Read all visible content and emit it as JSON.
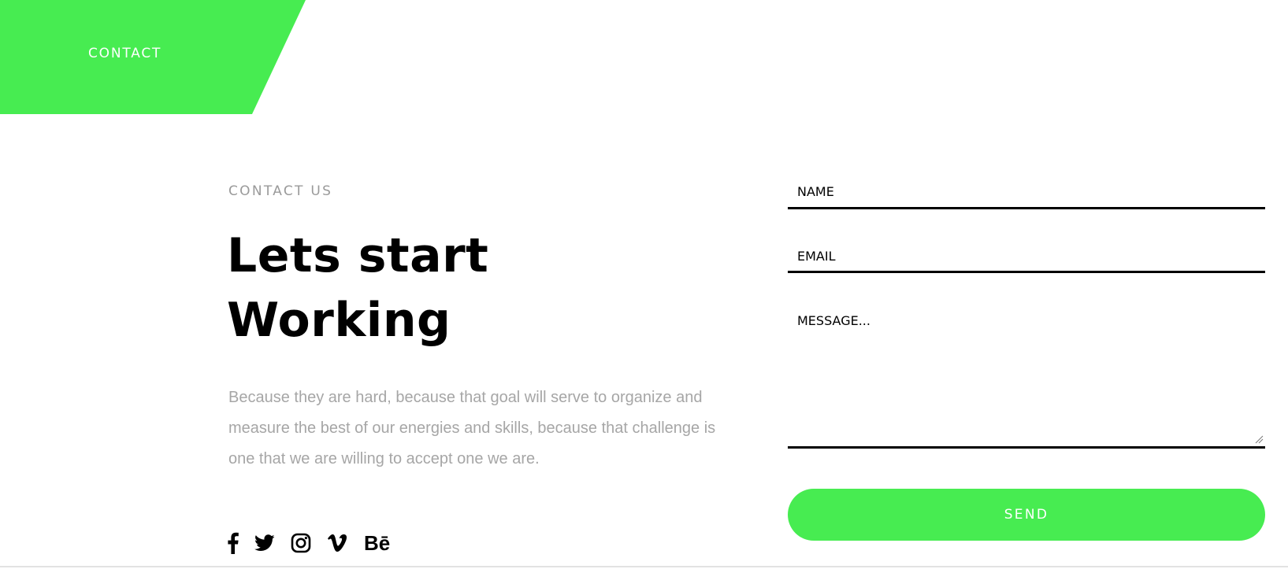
{
  "banner": {
    "label": "CONTACT"
  },
  "intro": {
    "eyebrow": "CONTACT US",
    "heading_line1": "Lets start",
    "heading_line2": "Working",
    "description": "Because they are hard, because that goal will serve to organize and measure the best of our energies and skills, because that challenge is one that we are willing to accept one we are."
  },
  "social": {
    "icons": [
      "facebook-icon",
      "twitter-icon",
      "instagram-icon",
      "vimeo-icon",
      "behance-icon"
    ],
    "behance_text": "Bē"
  },
  "form": {
    "name_placeholder": "NAME",
    "email_placeholder": "EMAIL",
    "message_placeholder": "MESSAGE...",
    "send_label": "SEND"
  },
  "colors": {
    "accent": "#47ec51",
    "text": "#000000",
    "muted": "#a6a6a6",
    "eyebrow": "#9a9a9a"
  }
}
